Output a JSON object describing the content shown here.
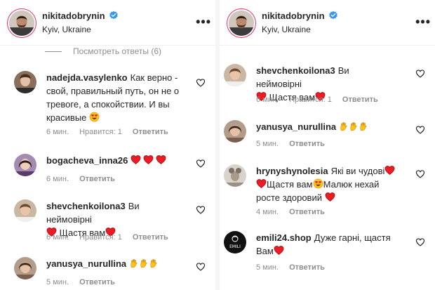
{
  "left": {
    "header": {
      "username": "nikitadobrynin",
      "location": "Kyiv, Ukraine"
    },
    "view_replies": "Посмотреть ответы (6)",
    "comments": [
      {
        "user": "nadejda.vasylenko",
        "text": "Как верно - свой, правильный путь, он не о тревоге, а спокойствии. И вы красивые",
        "time": "6 мин.",
        "likes": "Нравится: 1",
        "reply": "Ответить"
      },
      {
        "user": "bogacheva_inna26",
        "text": "",
        "time": "6 мин.",
        "likes": "",
        "reply": "Ответить"
      },
      {
        "user": "shevchenkoilona3",
        "text": "Ви неймовірні",
        "text2": "Щастя вам",
        "time": "6 мин.",
        "likes": "Нравится: 1",
        "reply": "Ответить"
      },
      {
        "user": "yanusya_nurullina",
        "text": "",
        "time": "5 мин.",
        "likes": "",
        "reply": "Ответить"
      }
    ]
  },
  "right": {
    "header": {
      "username": "nikitadobrynin",
      "location": "Kyiv, Ukraine"
    },
    "comments": [
      {
        "user": "shevchenkoilona3",
        "text": "Ви неймовірні",
        "text2": "Щастя вам",
        "time": "6 мин.",
        "likes": "Нравится: 1",
        "reply": "Ответить"
      },
      {
        "user": "yanusya_nurullina",
        "text": "",
        "time": "5 мин.",
        "likes": "",
        "reply": "Ответить"
      },
      {
        "user": "hrynyshynolesia",
        "text": "Які ви чудові",
        "text2": "Щастя вам",
        "text3": "Малюк нехай росте здоровий",
        "time": "4 мин.",
        "likes": "",
        "reply": "Ответить"
      },
      {
        "user": "emili24.shop",
        "text": "Дуже гарні, щастя Вам",
        "avatar_text": "EMILI",
        "time": "5 мин.",
        "likes": "",
        "reply": "Ответить"
      }
    ]
  },
  "more_icon": "•••",
  "colors": {
    "verified": "#3897f0",
    "heart_red": "#ed1c24",
    "meta_gray": "#8e8e8e",
    "story_ring": "#e1306c"
  }
}
